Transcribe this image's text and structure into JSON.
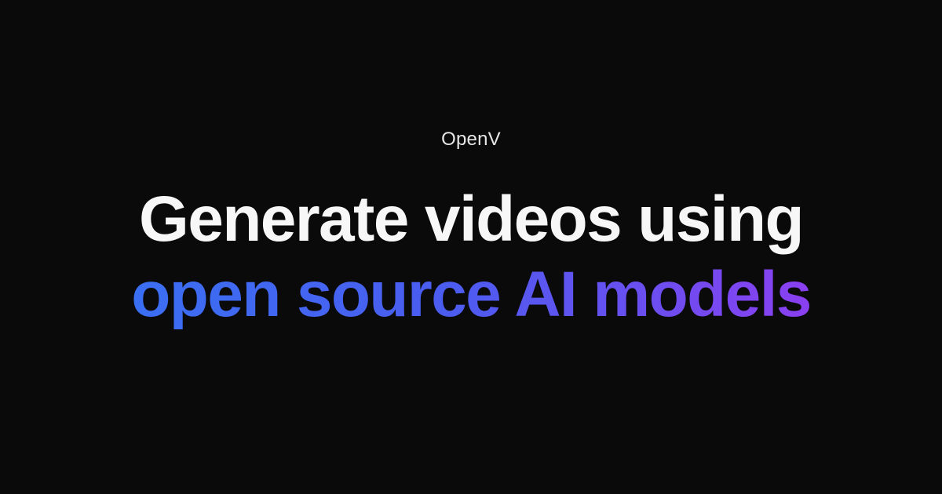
{
  "brand": {
    "name": "OpenV"
  },
  "headline": {
    "line1": "Generate videos using",
    "line2": "open source AI models"
  },
  "colors": {
    "background": "#0a0a0a",
    "brand_text": "#e6e6e6",
    "headline_text": "#f7f7f7",
    "gradient_start": "#3a6ff2",
    "gradient_end": "#8a3ff0"
  }
}
